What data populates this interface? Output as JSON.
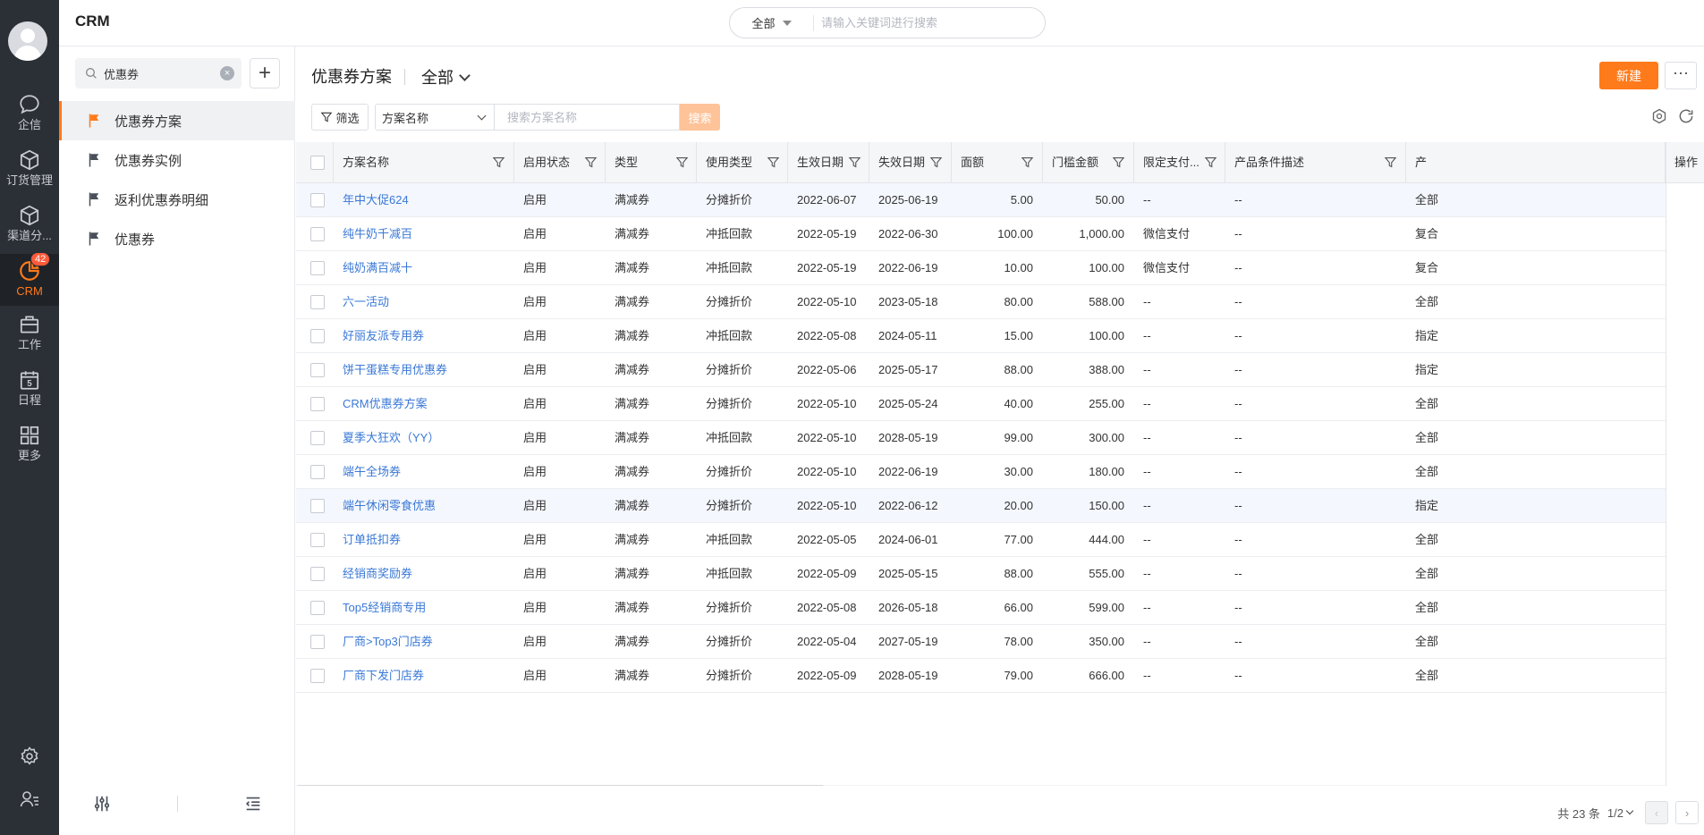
{
  "rail": {
    "items": [
      {
        "label": "企信",
        "icon": "chat-icon"
      },
      {
        "label": "订货管理",
        "icon": "box-icon"
      },
      {
        "label": "渠道分...",
        "icon": "cube-icon"
      },
      {
        "label": "CRM",
        "icon": "crm-icon",
        "badge": "42"
      },
      {
        "label": "工作",
        "icon": "briefcase-icon"
      },
      {
        "label": "日程",
        "icon": "calendar-icon",
        "calendar_day": "5"
      },
      {
        "label": "更多",
        "icon": "grid-icon"
      }
    ]
  },
  "topbar": {
    "title": "CRM",
    "search_scope": "全部",
    "search_placeholder": "请输入关键词进行搜索"
  },
  "sidebar": {
    "search_value": "优惠券",
    "items": [
      {
        "label": "优惠券方案",
        "active": true
      },
      {
        "label": "优惠券实例",
        "active": false
      },
      {
        "label": "返利优惠券明细",
        "active": false
      },
      {
        "label": "优惠券",
        "active": false
      }
    ]
  },
  "main": {
    "title": "优惠券方案",
    "view": "全部",
    "new_label": "新建",
    "more_label": "···",
    "filter_label": "筛选",
    "field_select": "方案名称",
    "search_placeholder": "搜索方案名称",
    "search_button": "搜索"
  },
  "table": {
    "headers": [
      "方案名称",
      "启用状态",
      "类型",
      "使用类型",
      "生效日期",
      "失效日期",
      "面额",
      "门槛金额",
      "限定支付...",
      "产品条件描述",
      "产",
      "操作"
    ],
    "rows": [
      {
        "name": "年中大促624",
        "status": "启用",
        "type": "满减券",
        "use": "分摊折价",
        "start": "2022-06-07",
        "end": "2025-06-19",
        "amount": "5.00",
        "threshold": "50.00",
        "pay": "--",
        "desc": "--",
        "prod": "全部",
        "hl": true
      },
      {
        "name": "纯牛奶千减百",
        "status": "启用",
        "type": "满减券",
        "use": "冲抵回款",
        "start": "2022-05-19",
        "end": "2022-06-30",
        "amount": "100.00",
        "threshold": "1,000.00",
        "pay": "微信支付",
        "desc": "--",
        "prod": "复合",
        "hl": false
      },
      {
        "name": "纯奶满百减十",
        "status": "启用",
        "type": "满减券",
        "use": "冲抵回款",
        "start": "2022-05-19",
        "end": "2022-06-19",
        "amount": "10.00",
        "threshold": "100.00",
        "pay": "微信支付",
        "desc": "--",
        "prod": "复合",
        "hl": false
      },
      {
        "name": "六一活动",
        "status": "启用",
        "type": "满减券",
        "use": "分摊折价",
        "start": "2022-05-10",
        "end": "2023-05-18",
        "amount": "80.00",
        "threshold": "588.00",
        "pay": "--",
        "desc": "--",
        "prod": "全部",
        "hl": false
      },
      {
        "name": "好丽友派专用券",
        "status": "启用",
        "type": "满减券",
        "use": "冲抵回款",
        "start": "2022-05-08",
        "end": "2024-05-11",
        "amount": "15.00",
        "threshold": "100.00",
        "pay": "--",
        "desc": "--",
        "prod": "指定",
        "hl": false
      },
      {
        "name": "饼干蛋糕专用优惠券",
        "status": "启用",
        "type": "满减券",
        "use": "分摊折价",
        "start": "2022-05-06",
        "end": "2025-05-17",
        "amount": "88.00",
        "threshold": "388.00",
        "pay": "--",
        "desc": "--",
        "prod": "指定",
        "hl": false
      },
      {
        "name": "CRM优惠券方案",
        "status": "启用",
        "type": "满减券",
        "use": "分摊折价",
        "start": "2022-05-10",
        "end": "2025-05-24",
        "amount": "40.00",
        "threshold": "255.00",
        "pay": "--",
        "desc": "--",
        "prod": "全部",
        "hl": false
      },
      {
        "name": "夏季大狂欢（YY）",
        "status": "启用",
        "type": "满减券",
        "use": "冲抵回款",
        "start": "2022-05-10",
        "end": "2028-05-19",
        "amount": "99.00",
        "threshold": "300.00",
        "pay": "--",
        "desc": "--",
        "prod": "全部",
        "hl": false
      },
      {
        "name": "端午全场券",
        "status": "启用",
        "type": "满减券",
        "use": "分摊折价",
        "start": "2022-05-10",
        "end": "2022-06-19",
        "amount": "30.00",
        "threshold": "180.00",
        "pay": "--",
        "desc": "--",
        "prod": "全部",
        "hl": false
      },
      {
        "name": "端午休闲零食优惠",
        "status": "启用",
        "type": "满减券",
        "use": "分摊折价",
        "start": "2022-05-10",
        "end": "2022-06-12",
        "amount": "20.00",
        "threshold": "150.00",
        "pay": "--",
        "desc": "--",
        "prod": "指定",
        "hl": true
      },
      {
        "name": "订单抵扣券",
        "status": "启用",
        "type": "满减券",
        "use": "冲抵回款",
        "start": "2022-05-05",
        "end": "2024-06-01",
        "amount": "77.00",
        "threshold": "444.00",
        "pay": "--",
        "desc": "--",
        "prod": "全部",
        "hl": false
      },
      {
        "name": "经销商奖励券",
        "status": "启用",
        "type": "满减券",
        "use": "冲抵回款",
        "start": "2022-05-09",
        "end": "2025-05-15",
        "amount": "88.00",
        "threshold": "555.00",
        "pay": "--",
        "desc": "--",
        "prod": "全部",
        "hl": false
      },
      {
        "name": "Top5经销商专用",
        "status": "启用",
        "type": "满减券",
        "use": "分摊折价",
        "start": "2022-05-08",
        "end": "2026-05-18",
        "amount": "66.00",
        "threshold": "599.00",
        "pay": "--",
        "desc": "--",
        "prod": "全部",
        "hl": false
      },
      {
        "name": "厂商>Top3门店券",
        "status": "启用",
        "type": "满减券",
        "use": "分摊折价",
        "start": "2022-05-04",
        "end": "2027-05-19",
        "amount": "78.00",
        "threshold": "350.00",
        "pay": "--",
        "desc": "--",
        "prod": "全部",
        "hl": false
      },
      {
        "name": "厂商下发门店券",
        "status": "启用",
        "type": "满减券",
        "use": "分摊折价",
        "start": "2022-05-09",
        "end": "2028-05-19",
        "amount": "79.00",
        "threshold": "666.00",
        "pay": "--",
        "desc": "--",
        "prod": "全部",
        "hl": false
      }
    ]
  },
  "pager": {
    "total": "共 23 条",
    "page": "1/2"
  },
  "colors": {
    "accent": "#ff7a1a",
    "rail": "#2b2f36",
    "link": "#3a78d6"
  }
}
